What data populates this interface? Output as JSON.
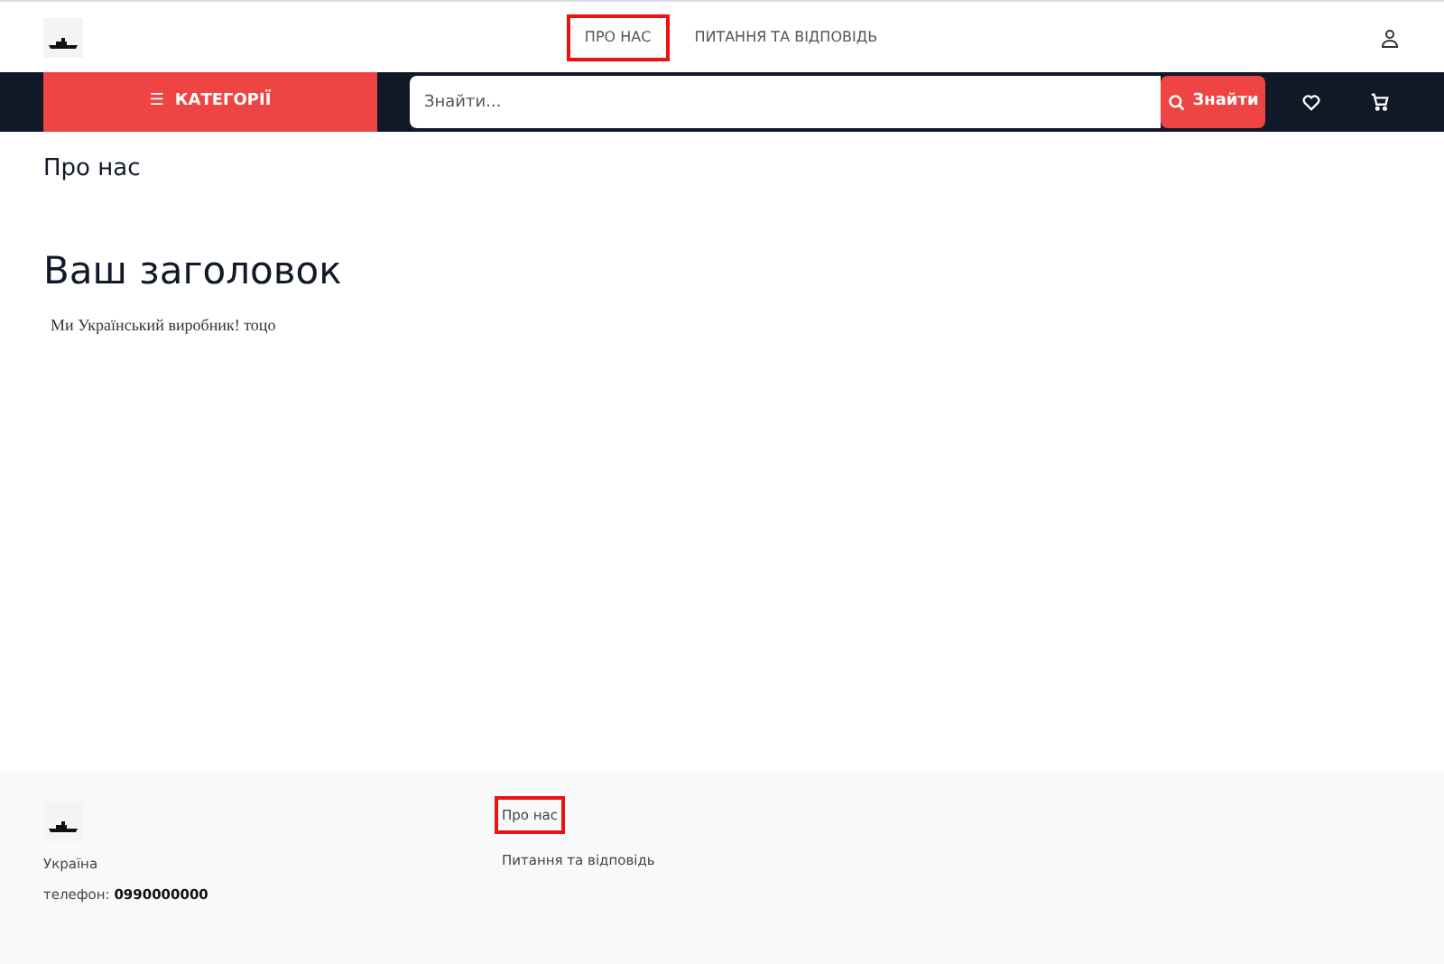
{
  "header": {
    "nav": [
      {
        "label": "ПРО НАС",
        "selected": true
      },
      {
        "label": "ПИТАННЯ ТА ВІДПОВІДЬ",
        "selected": false
      }
    ]
  },
  "toolbar": {
    "categories": {
      "icon": "☰",
      "label": "КАТЕГОРІЇ"
    },
    "search": {
      "placeholder": "Знайти..."
    },
    "search_button": "Знайти"
  },
  "page": {
    "breadcrumb_title": "Про нас",
    "heading": "Ваш заголовок",
    "body": "Ми Український виробник! тоцо"
  },
  "footer": {
    "country": "Україна",
    "phone_label": "телефон:",
    "phone": "0990000000",
    "links": [
      {
        "label": "Про нас",
        "selected": true
      },
      {
        "label": "Питання та відповідь",
        "selected": false
      }
    ]
  }
}
